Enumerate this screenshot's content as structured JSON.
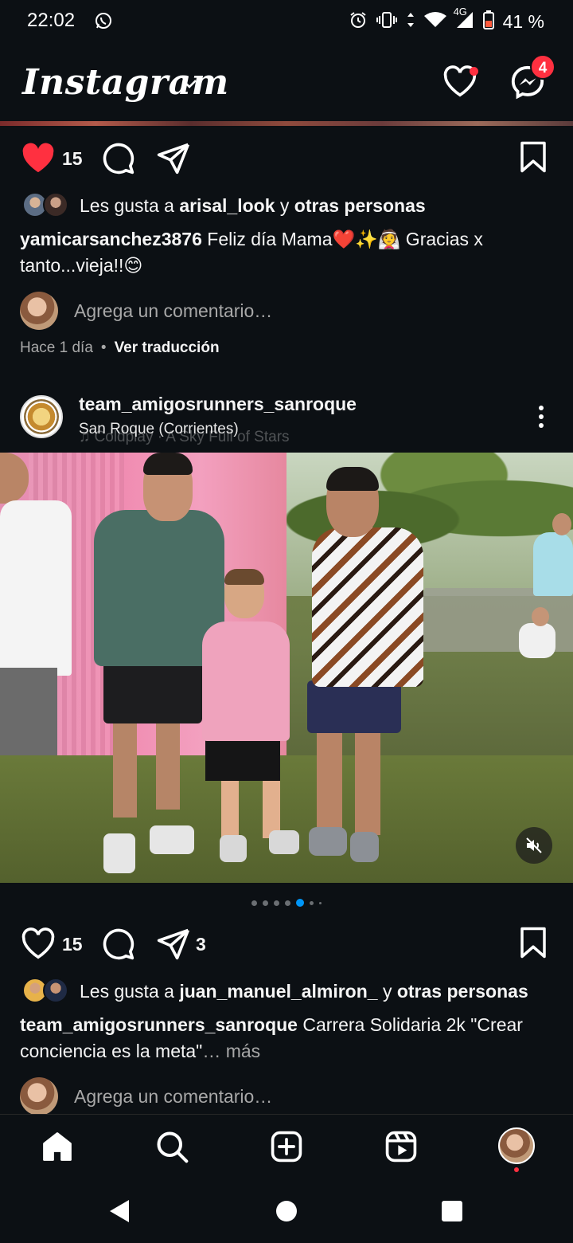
{
  "status_bar": {
    "time": "22:02",
    "network": "4G",
    "battery": "41 %",
    "icons": [
      "whatsapp-icon",
      "alarm-icon",
      "vibrate-icon",
      "data-arrows-icon",
      "wifi-icon",
      "signal-icon",
      "battery-icon"
    ]
  },
  "header": {
    "logo": "Instagram",
    "messages_badge": "4"
  },
  "post1": {
    "likes_count": "15",
    "liked": true,
    "likes_prefix": "Les gusta a ",
    "likes_user": "arisal_look",
    "likes_mid": " y ",
    "likes_others": "otras personas",
    "caption_user": "yamicarsanchez3876",
    "caption_text": " Feliz día Mama❤️✨👰 Gracias x tanto...vieja!!😊",
    "comment_placeholder": "Agrega un comentario…",
    "time_ago": "Hace 1 día",
    "separator": "•",
    "translate": "Ver traducción"
  },
  "post2": {
    "username": "team_amigosrunners_sanroque",
    "location": "San Roque (Corrientes)",
    "music": "♫ Coldplay · A Sky Full of Stars",
    "carousel": {
      "total": 7,
      "active": 5
    },
    "likes_count": "15",
    "shares_count": "3",
    "likes_prefix": "Les gusta a ",
    "likes_user": "juan_manuel_almiron_",
    "likes_mid": " y ",
    "likes_others": "otras personas",
    "caption_user": "team_amigosrunners_sanroque",
    "caption_text": " Carrera Solidaria 2k \"Crear conciencia es la meta\"",
    "more": "… más",
    "comment_placeholder": "Agrega un comentario…"
  },
  "colors": {
    "background": "#0c1014",
    "like_red": "#ff3040",
    "accent_blue": "#0095f6"
  }
}
